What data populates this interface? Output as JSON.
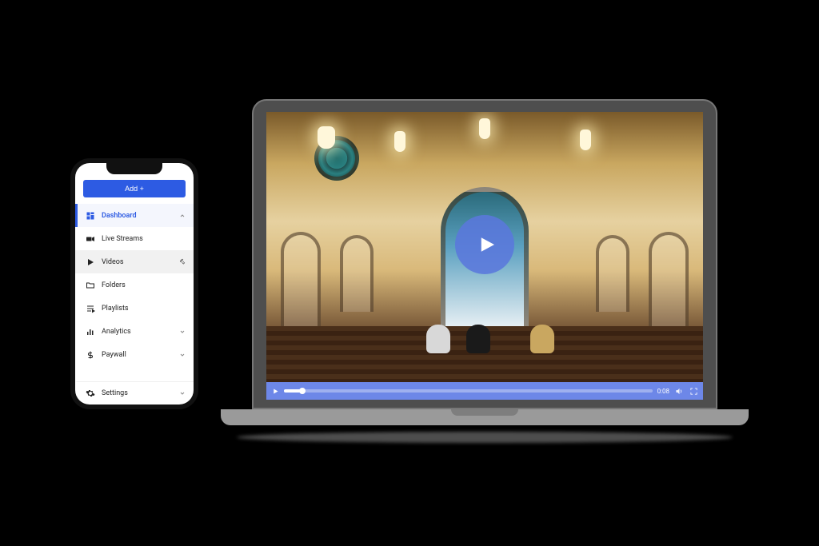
{
  "colors": {
    "accent": "#2d5be3",
    "player_bar": "#6d87e8"
  },
  "phone": {
    "add_button_label": "Add +",
    "nav": [
      {
        "icon": "dashboard-icon",
        "label": "Dashboard",
        "active": true,
        "expandable": true
      },
      {
        "icon": "camera-icon",
        "label": "Live Streams",
        "active": false,
        "expandable": false
      },
      {
        "icon": "play-icon",
        "label": "Videos",
        "active": false,
        "expandable": false,
        "selected": true
      },
      {
        "icon": "folder-icon",
        "label": "Folders",
        "active": false,
        "expandable": false
      },
      {
        "icon": "playlist-icon",
        "label": "Playlists",
        "active": false,
        "expandable": false
      },
      {
        "icon": "analytics-icon",
        "label": "Analytics",
        "active": false,
        "expandable": true
      },
      {
        "icon": "dollar-icon",
        "label": "Paywall",
        "active": false,
        "expandable": true
      }
    ],
    "settings_label": "Settings"
  },
  "player": {
    "time_label": "0:08",
    "progress_percent": 5
  }
}
